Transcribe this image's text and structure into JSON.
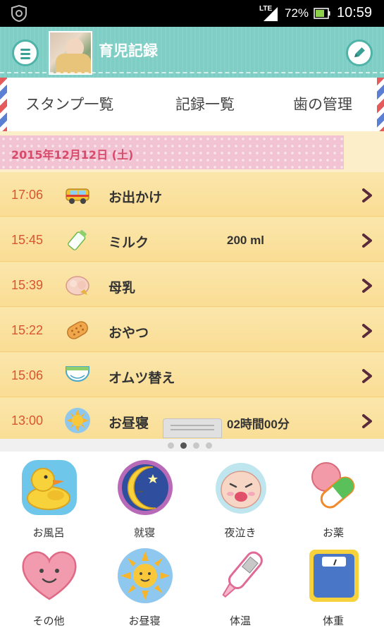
{
  "status_bar": {
    "network": "LTE",
    "battery": "72%",
    "time": "10:59"
  },
  "app_bar": {
    "title": "育児記録",
    "menu_icon": "hamburger-icon",
    "edit_icon": "pencil-icon"
  },
  "tabs": [
    {
      "label": "スタンプ一覧"
    },
    {
      "label": "記録一覧"
    },
    {
      "label": "歯の管理"
    }
  ],
  "date_header": "2015年12月12日 (土)",
  "records": [
    {
      "time": "17:06",
      "icon": "car-icon",
      "label": "お出かけ",
      "value": ""
    },
    {
      "time": "15:45",
      "icon": "milk-bottle-icon",
      "label": "ミルク",
      "value": "200 ml"
    },
    {
      "time": "15:39",
      "icon": "breastfeeding-icon",
      "label": "母乳",
      "value": ""
    },
    {
      "time": "15:22",
      "icon": "snack-icon",
      "label": "おやつ",
      "value": ""
    },
    {
      "time": "15:06",
      "icon": "diaper-icon",
      "label": "オムツ替え",
      "value": ""
    },
    {
      "time": "13:00",
      "icon": "sun-icon",
      "label": "お昼寝",
      "value": "02時間00分"
    }
  ],
  "pager": {
    "pages": 4,
    "active": 1
  },
  "stamps": [
    {
      "label": "お風呂",
      "icon": "rubber-duck-icon"
    },
    {
      "label": "就寝",
      "icon": "moon-icon"
    },
    {
      "label": "夜泣き",
      "icon": "crying-baby-icon"
    },
    {
      "label": "お薬",
      "icon": "pill-icon"
    },
    {
      "label": "その他",
      "icon": "heart-icon"
    },
    {
      "label": "お昼寝",
      "icon": "sun-icon"
    },
    {
      "label": "体温",
      "icon": "thermometer-icon"
    },
    {
      "label": "体重",
      "icon": "scale-icon"
    }
  ],
  "colors": {
    "header_teal": "#7ecec5",
    "date_text": "#d84a6a",
    "time_text": "#d8552e",
    "list_bg": "#fbe3a2"
  }
}
